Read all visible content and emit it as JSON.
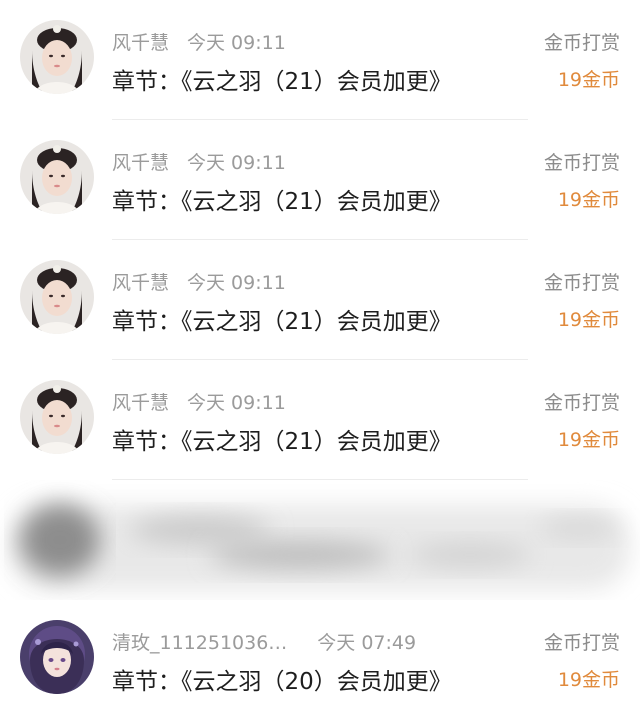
{
  "rows": [
    {
      "username": "风千慧",
      "time": "今天 09:11",
      "chapter": "章节：《云之羽（21）会员加更》",
      "action": "金币打赏",
      "coins": "19金币"
    },
    {
      "username": "风千慧",
      "time": "今天 09:11",
      "chapter": "章节：《云之羽（21）会员加更》",
      "action": "金币打赏",
      "coins": "19金币"
    },
    {
      "username": "风千慧",
      "time": "今天 09:11",
      "chapter": "章节：《云之羽（21）会员加更》",
      "action": "金币打赏",
      "coins": "19金币"
    },
    {
      "username": "风千慧",
      "time": "今天 09:11",
      "chapter": "章节：《云之羽（21）会员加更》",
      "action": "金币打赏",
      "coins": "19金币"
    },
    {
      "username": "清玫_111251036…",
      "time": "今天 07:49",
      "chapter": "章节：《云之羽（20）会员加更》",
      "action": "金币打赏",
      "coins": "19金币"
    }
  ],
  "colors": {
    "meta_gray": "#9b9b9b",
    "chapter_text": "#1e1e1e",
    "coin_orange": "#e08a3c",
    "divider": "#ececec"
  },
  "icons": {
    "avatar_1": "woman-portrait-avatar",
    "avatar_2": "illustrated-girl-avatar"
  }
}
